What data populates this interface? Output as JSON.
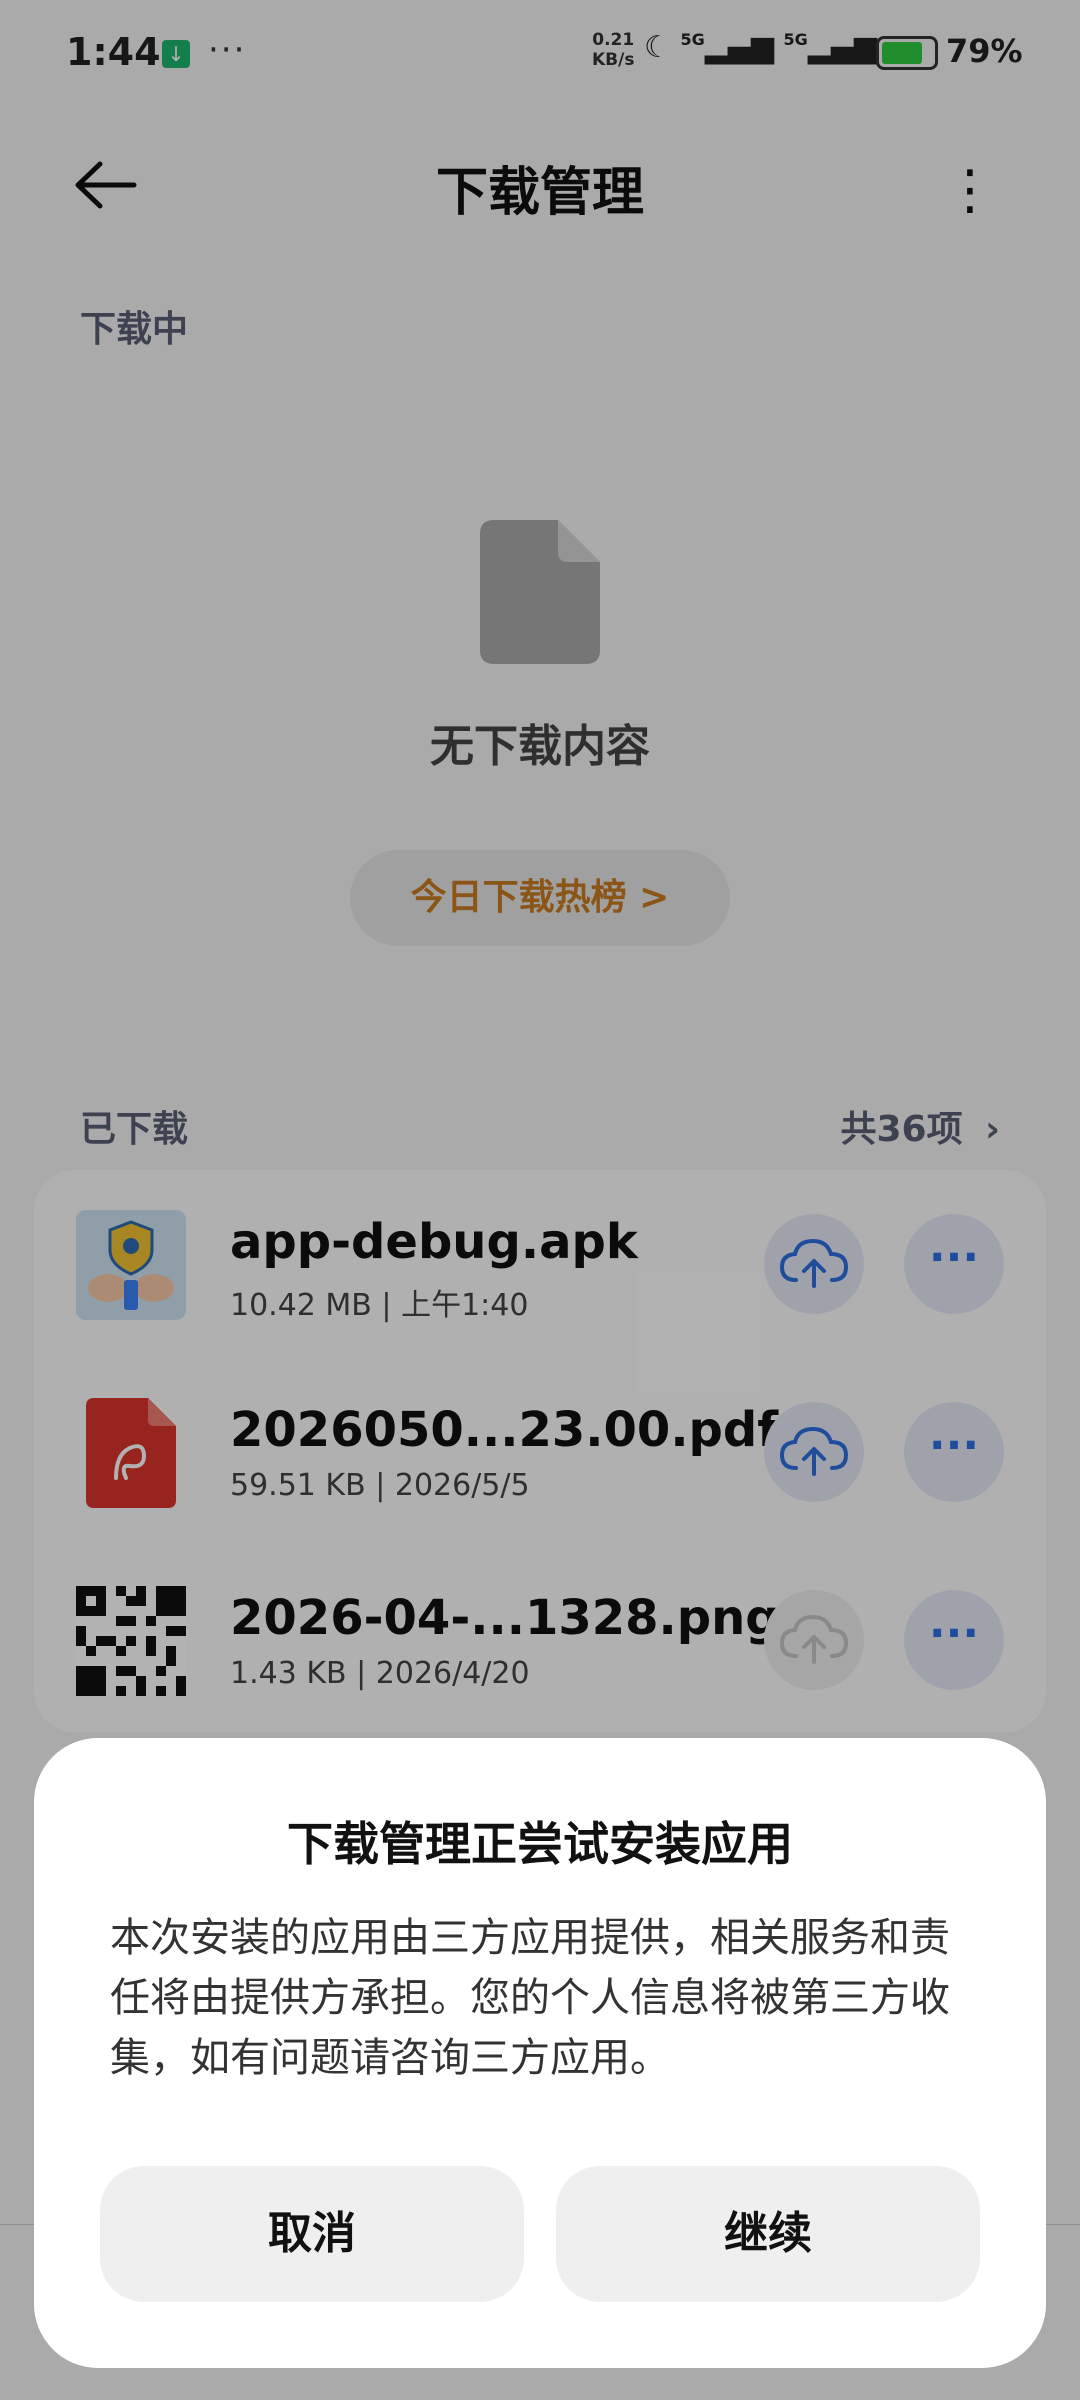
{
  "status_bar": {
    "time": "1:44",
    "speed_value": "0.21",
    "speed_unit": "KB/s",
    "network": "5G",
    "network2": "5G",
    "battery": "79%",
    "battery_level": 0.79
  },
  "header": {
    "title": "下载管理"
  },
  "downloading": {
    "label": "下载中",
    "empty_text": "无下载内容",
    "hot_button": "今日下载热榜 >"
  },
  "downloaded": {
    "label": "已下载",
    "count": "共36项",
    "items": [
      {
        "name": "app-debug.apk",
        "meta": "10.42 MB | 上午1:40",
        "upload_enabled": true
      },
      {
        "name": "2026050...23.00.pdf",
        "meta": "59.51 KB | 2026/5/5",
        "upload_enabled": true
      },
      {
        "name": "2026-04-...1328.png",
        "meta": "1.43 KB | 2026/4/20",
        "upload_enabled": false
      }
    ]
  },
  "dialog": {
    "title": "下载管理正尝试安装应用",
    "body": "本次安装的应用由三方应用提供，相关服务和责任将由提供方承担。您的个人信息将被第三方收集，如有问题请咨询三方应用。",
    "cancel": "取消",
    "continue": "继续"
  },
  "colors": {
    "accent_orange": "#c87a22",
    "accent_blue": "#2f6ee0",
    "pdf_red": "#d9342b",
    "download_notif_green": "#1db66b"
  }
}
